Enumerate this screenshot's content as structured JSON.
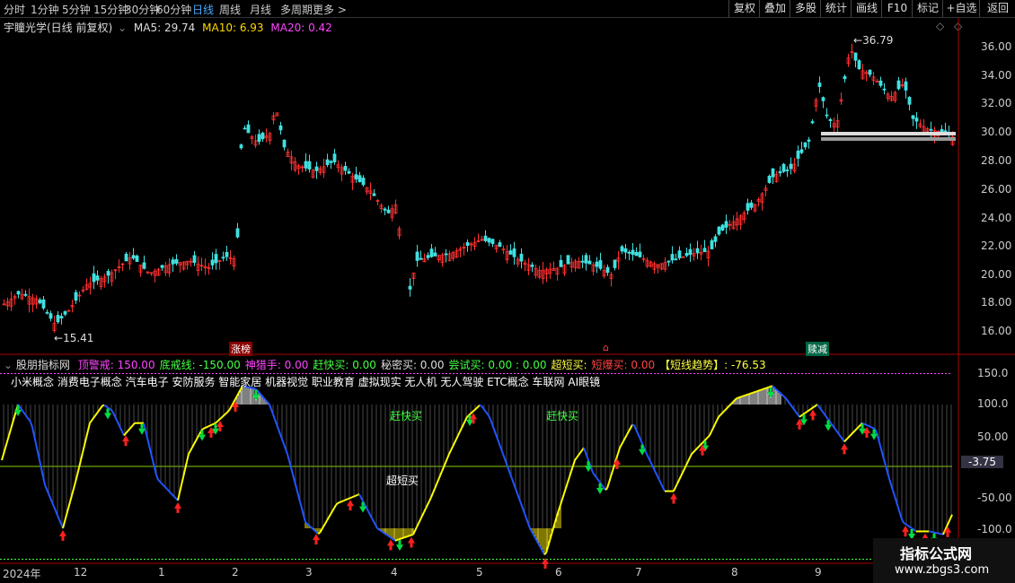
{
  "toolbar": {
    "periods": [
      "分时",
      "1分钟",
      "5分钟",
      "15分钟",
      "30分钟",
      "60分钟",
      "日线",
      "周线",
      "月线",
      "多周期",
      "更多 >"
    ],
    "active_period": "日线",
    "buttons": [
      "复权",
      "叠加",
      "多股",
      "统计",
      "画线",
      "F10",
      "标记",
      "+自选",
      "返回"
    ]
  },
  "main_chart": {
    "title": "宇瞳光学(日线 前复权)",
    "ma5_label": "MA5: 29.74",
    "ma10_label": "MA10: 6.93",
    "ma20_label": "MA20: 0.42",
    "high_label": "36.79",
    "low_label": "15.41",
    "y_ticks": [
      "36.00",
      "34.00",
      "32.00",
      "30.00",
      "28.00",
      "26.00",
      "24.00",
      "22.00",
      "20.00",
      "18.00",
      "16.00"
    ],
    "event_tags": [
      "涨榜",
      "",
      "赎减"
    ]
  },
  "indicator": {
    "name": "股朋指标网",
    "params": [
      {
        "text": "顶警戒: 150.00",
        "color": "#ff44ff"
      },
      {
        "text": "底戒线: -150.00",
        "color": "#44ff44"
      },
      {
        "text": "神猎手: 0.00",
        "color": "#ff44ff"
      },
      {
        "text": "赶快买: 0.00",
        "color": "#44ff44"
      },
      {
        "text": "秘密买: 0.00",
        "color": "#dddddd"
      },
      {
        "text": "尝试买: 0.00 : 0.00",
        "color": "#44ff44"
      },
      {
        "text": "超短买:",
        "color": "#ffff44"
      },
      {
        "text": "短爆买: 0.00",
        "color": "#ff4444"
      },
      {
        "text": "【短线趋势】: -76.53",
        "color": "#ffff44"
      }
    ],
    "concepts": "小米概念 消费电子概念 汽车电子 安防服务 智能家居 机器视觉 职业教育 虚拟现实 无人机 无人驾驶 ETC概念 车联网 AI眼镜",
    "signal_labels": [
      "赶快买",
      "赶快买",
      "超短买"
    ],
    "y_ticks": [
      "150.0",
      "100.0",
      "50.00",
      "0.00",
      "-50.00",
      "-100.0"
    ],
    "current_value": "-3.75"
  },
  "time_axis": [
    "2024年",
    "12",
    "1",
    "2",
    "3",
    "4",
    "5",
    "6",
    "7",
    "8",
    "9"
  ],
  "watermark": {
    "title": "指标公式网",
    "url": "www.zbgs3.com"
  }
}
